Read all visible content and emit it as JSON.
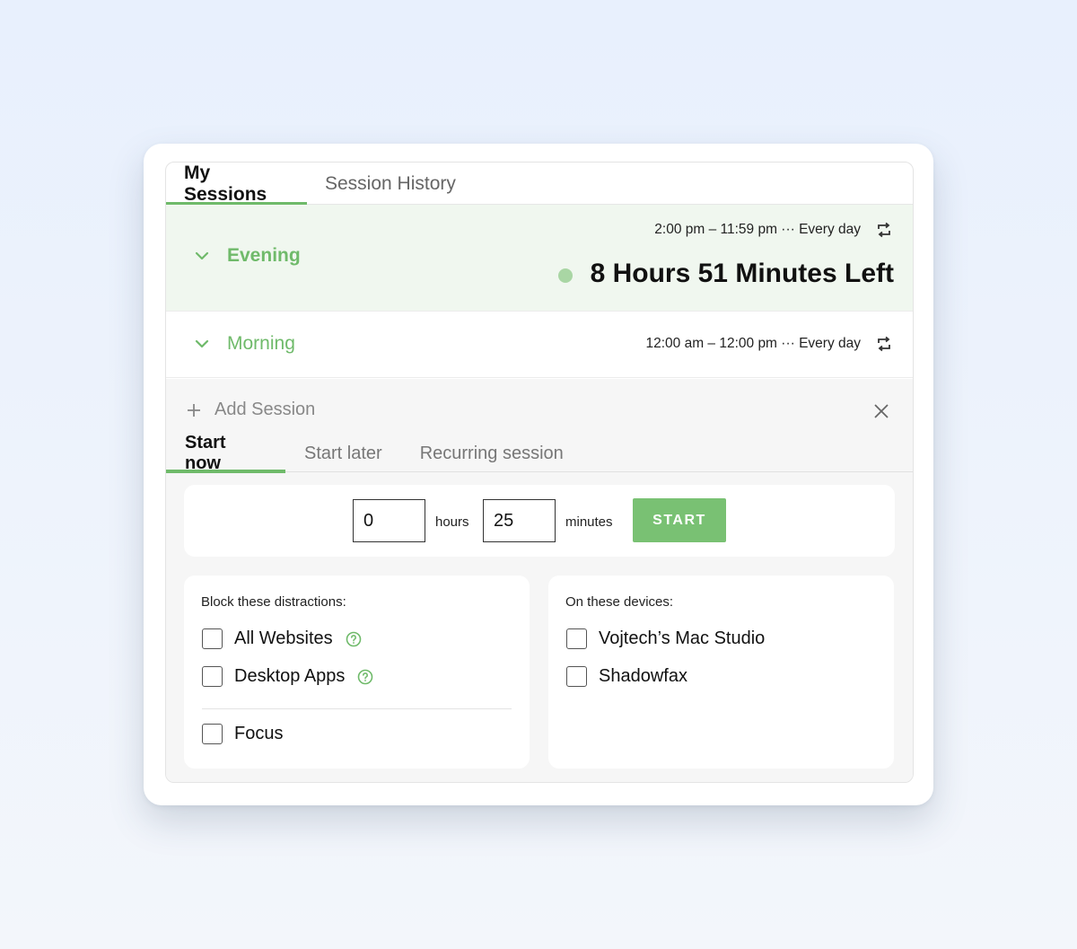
{
  "tabs": [
    {
      "label": "My Sessions",
      "active": true
    },
    {
      "label": "Session History",
      "active": false
    }
  ],
  "sessions": {
    "evening": {
      "name": "Evening",
      "schedule": "2:00 pm – 11:59 pm ··· Every day",
      "time_left": "8 Hours 51 Minutes Left",
      "active": true
    },
    "morning": {
      "name": "Morning",
      "schedule": "12:00 am – 12:00 pm ··· Every day",
      "active": false
    }
  },
  "add_session": {
    "label": "Add Session",
    "subtabs": [
      {
        "label": "Start now",
        "active": true
      },
      {
        "label": "Start later",
        "active": false
      },
      {
        "label": "Recurring session",
        "active": false
      }
    ],
    "hours_value": "0",
    "hours_label": "hours",
    "minutes_value": "25",
    "minutes_label": "minutes",
    "start_label": "START"
  },
  "distractions": {
    "title": "Block these distractions:",
    "items": [
      {
        "label": "All Websites",
        "checked": false
      },
      {
        "label": "Desktop Apps",
        "checked": false
      },
      {
        "label": "Focus",
        "checked": false
      }
    ]
  },
  "devices": {
    "title": "On these devices:",
    "items": [
      {
        "label": "Vojtech’s Mac Studio",
        "checked": false
      },
      {
        "label": "Shadowfax",
        "checked": false
      }
    ]
  },
  "colors": {
    "accent": "#6fba6a",
    "start_button": "#79c173",
    "active_row_bg": "#f0f7ef",
    "active_dot": "#a9d6a4"
  },
  "icons": {
    "chevron": "chevron-down-icon",
    "repeat": "repeat-icon",
    "plus": "plus-icon",
    "close": "close-icon",
    "help": "help-icon"
  }
}
